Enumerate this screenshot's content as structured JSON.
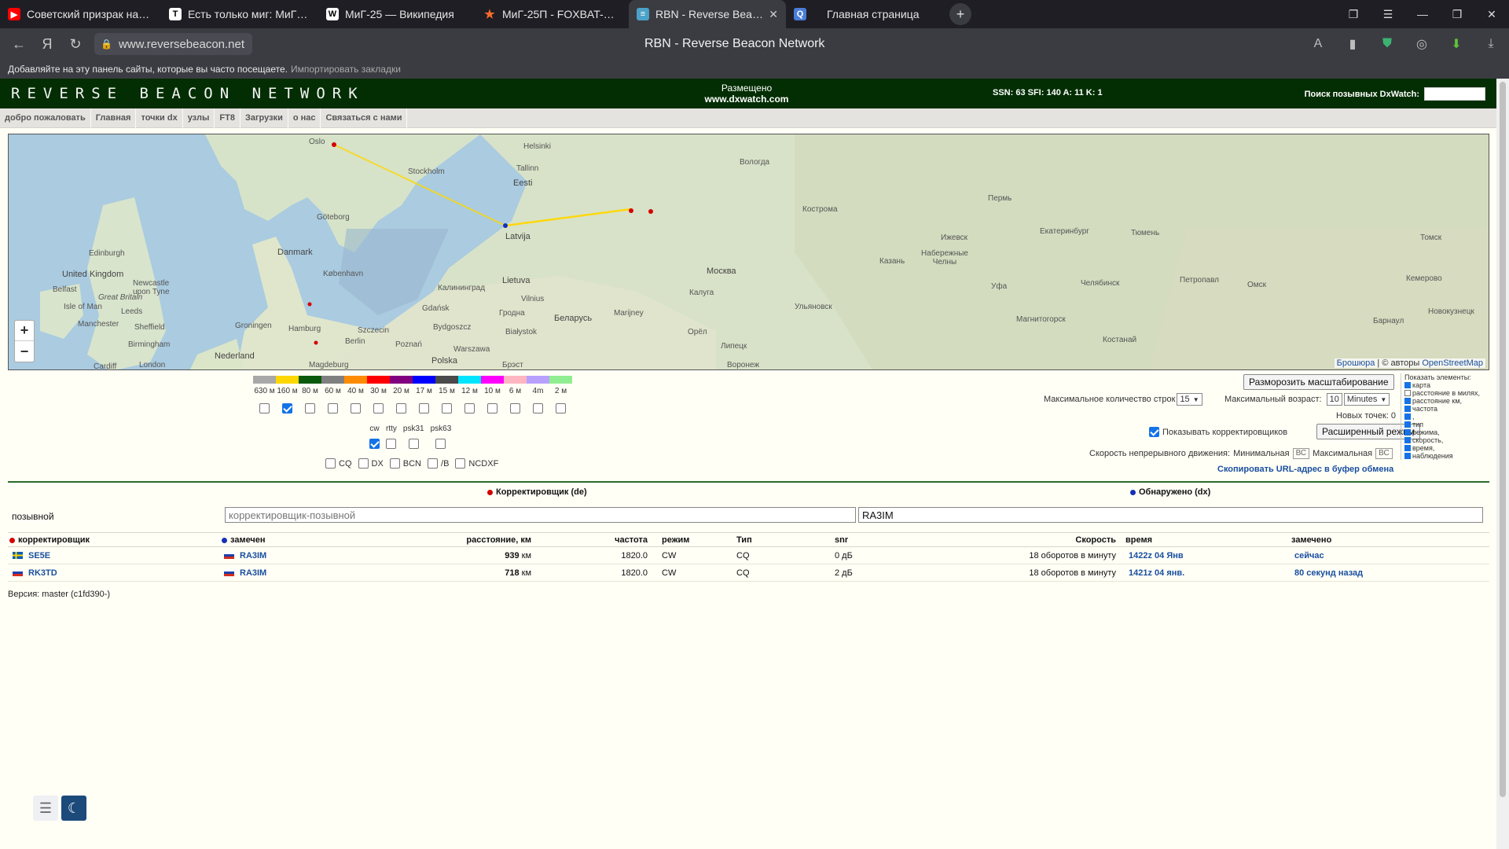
{
  "browser": {
    "tabs": [
      {
        "label": "Советский призрак над ст",
        "icon": "youtube-icon",
        "color": "#ff0000"
      },
      {
        "label": "Есть только миг: МиГ-25",
        "icon": "t-icon",
        "color": "#ffffff"
      },
      {
        "label": "МиГ-25 — Википедия",
        "icon": "wikipedia-icon",
        "color": "#ffffff"
      },
      {
        "label": "МиГ-25П - FOXBAT-A, -C,",
        "icon": "star-icon",
        "color": "#ff6a2b"
      },
      {
        "label": "RBN - Reverse Beacon N",
        "icon": "rbn-icon",
        "color": "#4aa2c8",
        "active": true
      },
      {
        "label": "Главная страница",
        "icon": "search-icon",
        "color": "#4a7dd8"
      }
    ],
    "url": "www.reversebeacon.net",
    "page_title": "RBN - Reverse Beacon Network",
    "bookmarks_hint": "Добавляйте на эту панель сайты, которые вы часто посещаете.",
    "bookmarks_import": "Импортировать закладки"
  },
  "header": {
    "logo": "REVERSE BEACON NETWORK",
    "hosted_label": "Размещено",
    "hosted_site": "www.dxwatch.com",
    "solar": "SSN: 63 SFI: 140 A: 11 K: 1",
    "dx_search_label": "Поиск позывных DxWatch:"
  },
  "menu": [
    "добро пожаловать",
    "Главная",
    "точки dx",
    "узлы",
    "FT8",
    "Загрузки",
    "о нас",
    "Связаться с нами"
  ],
  "map": {
    "labels": [
      {
        "t": "Oslo"
      },
      {
        "t": "Helsinki"
      },
      {
        "t": "Tallinn"
      },
      {
        "t": "Stockholm"
      },
      {
        "t": "Eesti"
      },
      {
        "t": "Göteborg"
      },
      {
        "t": "Latvija"
      },
      {
        "t": "Danmark"
      },
      {
        "t": "København"
      },
      {
        "t": "Edinburgh"
      },
      {
        "t": "United Kingdom"
      },
      {
        "t": "Newcastle upon Tyne"
      },
      {
        "t": "Belfast"
      },
      {
        "t": "Great Britain"
      },
      {
        "t": "Isle of Man"
      },
      {
        "t": "Leeds"
      },
      {
        "t": "Manchester"
      },
      {
        "t": "Sheffield"
      },
      {
        "t": "Birmingham"
      },
      {
        "t": "London"
      },
      {
        "t": "Cardiff"
      },
      {
        "t": "Groningen"
      },
      {
        "t": "Hamburg"
      },
      {
        "t": "Nederland"
      },
      {
        "t": "Berlin"
      },
      {
        "t": "Szczecin"
      },
      {
        "t": "Poznań"
      },
      {
        "t": "Magdeburg"
      },
      {
        "t": "Gdańsk"
      },
      {
        "t": "Bydgoszcz"
      },
      {
        "t": "Калининград"
      },
      {
        "t": "Lietuva"
      },
      {
        "t": "Vilnius"
      },
      {
        "t": "Гродна"
      },
      {
        "t": "Białystok"
      },
      {
        "t": "Warszawa"
      },
      {
        "t": "Polska"
      },
      {
        "t": "Беларусь"
      },
      {
        "t": "Вологда"
      },
      {
        "t": "Кострома"
      },
      {
        "t": "Москва"
      },
      {
        "t": "Калуга"
      },
      {
        "t": "Орёл"
      },
      {
        "t": "Липецк"
      },
      {
        "t": "Воронеж"
      },
      {
        "t": "Казань"
      },
      {
        "t": "Ижевск"
      },
      {
        "t": "Набережные Челны"
      },
      {
        "t": "Пермь"
      },
      {
        "t": "Екатеринбург"
      },
      {
        "t": "Тюмень"
      },
      {
        "t": "Уфа"
      },
      {
        "t": "Челябинск"
      },
      {
        "t": "Магнитогорск"
      },
      {
        "t": "Костанай"
      },
      {
        "t": "Петропавл"
      },
      {
        "t": "Омск"
      },
      {
        "t": "Томск"
      },
      {
        "t": "Кемерово"
      },
      {
        "t": "Новокузнецк"
      },
      {
        "t": "Барнаул"
      },
      {
        "t": "Ульяновск"
      },
      {
        "t": "Marijney"
      },
      {
        "t": "Брэст"
      }
    ],
    "zoom_in": "+",
    "zoom_out": "−",
    "attribution_a": "Брошюра",
    "attribution_b": " | © авторы ",
    "attribution_c": "OpenStreetMap"
  },
  "bands": [
    {
      "label": "630 м",
      "color": "#a8a8a8",
      "checked": false
    },
    {
      "label": "160 м",
      "color": "#ffd700",
      "checked": true
    },
    {
      "label": "80 м",
      "color": "#0b5a0b",
      "checked": false
    },
    {
      "label": "60 м",
      "color": "#808080",
      "checked": false
    },
    {
      "label": "40 м",
      "color": "#ff8c00",
      "checked": false
    },
    {
      "label": "30 м",
      "color": "#ff0000",
      "checked": false
    },
    {
      "label": "20 м",
      "color": "#800080",
      "checked": false
    },
    {
      "label": "17 м",
      "color": "#0000ff",
      "checked": false
    },
    {
      "label": "15 м",
      "color": "#4a4a4a",
      "checked": false
    },
    {
      "label": "12 м",
      "color": "#00e5ff",
      "checked": false
    },
    {
      "label": "10 м",
      "color": "#ff00ff",
      "checked": false
    },
    {
      "label": "6 м",
      "color": "#ffb6c1",
      "checked": false
    },
    {
      "label": "4m",
      "color": "#b8a0ff",
      "checked": false
    },
    {
      "label": "2 м",
      "color": "#90ee90",
      "checked": false
    }
  ],
  "modes": [
    {
      "label": "cw",
      "checked": true
    },
    {
      "label": "rtty",
      "checked": false
    },
    {
      "label": "psk31",
      "checked": false
    },
    {
      "label": "psk63",
      "checked": false
    }
  ],
  "types": [
    {
      "label": "CQ",
      "checked": false
    },
    {
      "label": "DX",
      "checked": false
    },
    {
      "label": "BCN",
      "checked": false
    },
    {
      "label": "/B",
      "checked": false
    },
    {
      "label": "NCDXF",
      "checked": false
    }
  ],
  "controls": {
    "unfreeze": "Разморозить масштабирование",
    "max_rows_label": "Максимальное количество строк",
    "max_rows": "15",
    "max_age_label": "Максимальный возраст:",
    "max_age": "10",
    "max_age_unit": "Minutes",
    "new_points": "Новых точек: 0",
    "show_skimmers": "Показывать корректировщиков",
    "advanced": "Расширенный режим",
    "speed_label": "Скорость непрерывного движения:",
    "speed_min_label": "Минимальная",
    "speed_max_label": "Максимальная",
    "speed_placeholder": "ВС",
    "copy_url": "Скопировать URL-адрес в буфер обмена"
  },
  "show_panel": {
    "title": "Показать элементы:",
    "items": [
      {
        "label": "карта",
        "checked": true
      },
      {
        "label": "расстояние в милях,",
        "checked": false
      },
      {
        "label": "расстояние км,",
        "checked": true
      },
      {
        "label": "частота",
        "checked": true
      },
      {
        "label": ",",
        "checked": true
      },
      {
        "label": "тип",
        "checked": true
      },
      {
        "label": "режима,",
        "checked": true
      },
      {
        "label": "скорость,",
        "checked": true
      },
      {
        "label": "время,",
        "checked": true
      },
      {
        "label": "наблюдения",
        "checked": true
      }
    ]
  },
  "filter": {
    "de_title": "Корректировщик (de)",
    "dx_title": "Обнаружено (dx)",
    "row_label": "позывной",
    "de_placeholder": "корректировщик-позывной",
    "dx_value": "RA3IM"
  },
  "table": {
    "headers": {
      "spotter": "корректировщик",
      "spotted": "замечен",
      "distance": "расстояние, км",
      "freq": "частота",
      "mode": "режим",
      "type": "Тип",
      "snr": "snr",
      "speed": "Скорость",
      "time": "время",
      "seen": "замечено"
    },
    "rows": [
      {
        "spotter": "SE5E",
        "spotter_flag": "se",
        "spotted": "RA3IM",
        "spotted_flag": "ru",
        "distance": "939",
        "km": "км",
        "freq": "1820.0",
        "mode": "CW",
        "type": "CQ",
        "snr": "0 дБ",
        "speed": "18 оборотов в минуту",
        "time": "1422z 04 Янв",
        "seen": "сейчас"
      },
      {
        "spotter": "RK3TD",
        "spotter_flag": "ru",
        "spotted": "RA3IM",
        "spotted_flag": "ru",
        "distance": "718",
        "km": "км",
        "freq": "1820.0",
        "mode": "CW",
        "type": "CQ",
        "snr": "2 дБ",
        "speed": "18 оборотов в минуту",
        "time": "1421z 04 янв.",
        "seen": "80 секунд назад"
      }
    ]
  },
  "version": "Версия: master (c1fd390-)"
}
